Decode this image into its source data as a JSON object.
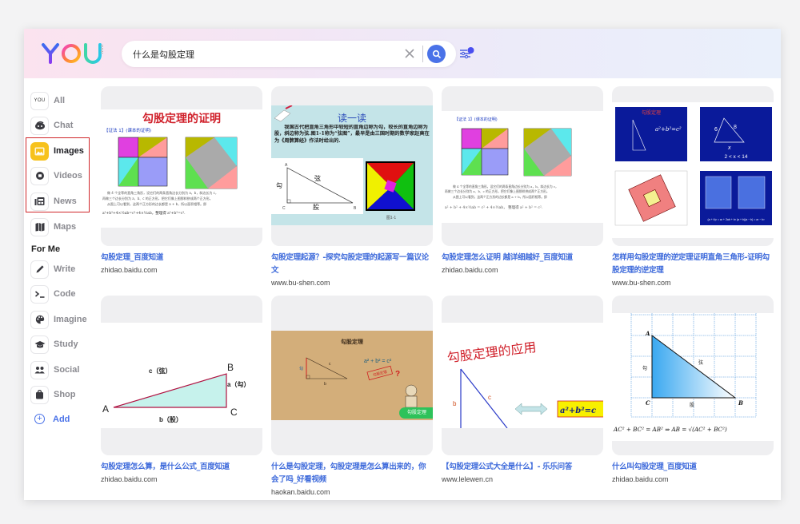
{
  "header": {
    "logo_text": "YOU",
    "search": {
      "value": "什么是勾股定理",
      "placeholder": ""
    },
    "icons": {
      "clear": "close-icon",
      "search": "search-icon",
      "filter": "sliders-icon"
    }
  },
  "sidebar": {
    "items": [
      {
        "label": "All",
        "icon": "you-logo-icon",
        "active": false
      },
      {
        "label": "Chat",
        "icon": "chat-bubble-icon",
        "active": false
      },
      {
        "label": "Images",
        "icon": "image-icon",
        "active": true
      },
      {
        "label": "Videos",
        "icon": "video-icon",
        "active": false
      },
      {
        "label": "News",
        "icon": "newspaper-icon",
        "active": false
      },
      {
        "label": "Maps",
        "icon": "map-icon",
        "active": false
      }
    ],
    "section_label": "For Me",
    "apps": [
      {
        "label": "Write",
        "icon": "pencil-icon"
      },
      {
        "label": "Code",
        "icon": "terminal-icon"
      },
      {
        "label": "Imagine",
        "icon": "palette-icon"
      },
      {
        "label": "Study",
        "icon": "graduation-cap-icon"
      },
      {
        "label": "Social",
        "icon": "people-icon"
      },
      {
        "label": "Shop",
        "icon": "shopping-bag-icon"
      }
    ],
    "add_label": "Add"
  },
  "results": [
    {
      "title": "勾股定理_百度知道",
      "source": "zhidao.baidu.com",
      "image": {
        "heading": "勾股定理的证明",
        "caption": "【证法 1】(课本的证明)",
        "formula": "a²+b²+4×½ab=c²+4×½ab，整理得 a²+b²=c²."
      }
    },
    {
      "title": "勾股定理起源？-探究勾股定理的起源写一篇议论文",
      "source": "www.bu-shen.com",
      "image": {
        "heading": "读一读",
        "body": "我国古代把直角三角形中较短的直角边称为勾，较长的直角边称为股，斜边称为弦.图1-1称为“弦图”，最早是由三国时期的数学家赵爽在为《周髀算经》作法时给出的.",
        "labels": [
          "A",
          "C",
          "B",
          "勾",
          "股",
          "弦"
        ],
        "figure_caption": "图1-1"
      }
    },
    {
      "title": "勾股定理怎么证明 越详细越好_百度知道",
      "source": "zhidao.baidu.com",
      "image": {
        "caption": "【证法 1】(课本的证明)"
      }
    },
    {
      "title": "怎样用勾股定理的逆定理证明直角三角形-证明勾股定理的逆定理",
      "source": "www.bu-shen.com",
      "image": {
        "slide1_title": "勾股定理",
        "slide1_formula": "a²+b²=c²",
        "slide2_labels": [
          "6",
          "8",
          "x"
        ],
        "slide2_range": "2 < x < 14"
      }
    },
    {
      "title": "勾股定理怎么算，是什么公式_百度知道",
      "source": "zhidao.baidu.com",
      "image": {
        "vertices": [
          "A",
          "B",
          "C"
        ],
        "sides": [
          "c（弦）",
          "a（勾）",
          "b（股）"
        ]
      }
    },
    {
      "title": "什么是勾股定理，勾股定理是怎么算出来的，你会了吗_好看视频",
      "source": "haokan.baidu.com",
      "image": {
        "heading": "勾股定理",
        "formula": "a² + b² = c²",
        "stamp": "勾股定理",
        "side_labels": [
          "勾",
          "b",
          "c"
        ],
        "badge": "勾股定理"
      }
    },
    {
      "title": "【勾股定理公式大全是什么】- 乐乐问答",
      "source": "www.lelewen.cn",
      "image": {
        "heading": "勾股定理的应用",
        "side_labels": [
          "b",
          "c"
        ],
        "formula": "a²+b²=c"
      }
    },
    {
      "title": "什么叫勾股定理_百度知道",
      "source": "zhidao.baidu.com",
      "image": {
        "vertices": [
          "A",
          "C",
          "B"
        ],
        "sides": [
          "勾",
          "股",
          "弦"
        ],
        "formula": "AC² + BC² = AB² ⇒ AB = √(AC² + BC²)"
      }
    }
  ],
  "colors": {
    "accent": "#4a72e8",
    "active_tab": "#f7c21d",
    "link": "#3f6bdb",
    "highlight_box": "#d0262a"
  }
}
